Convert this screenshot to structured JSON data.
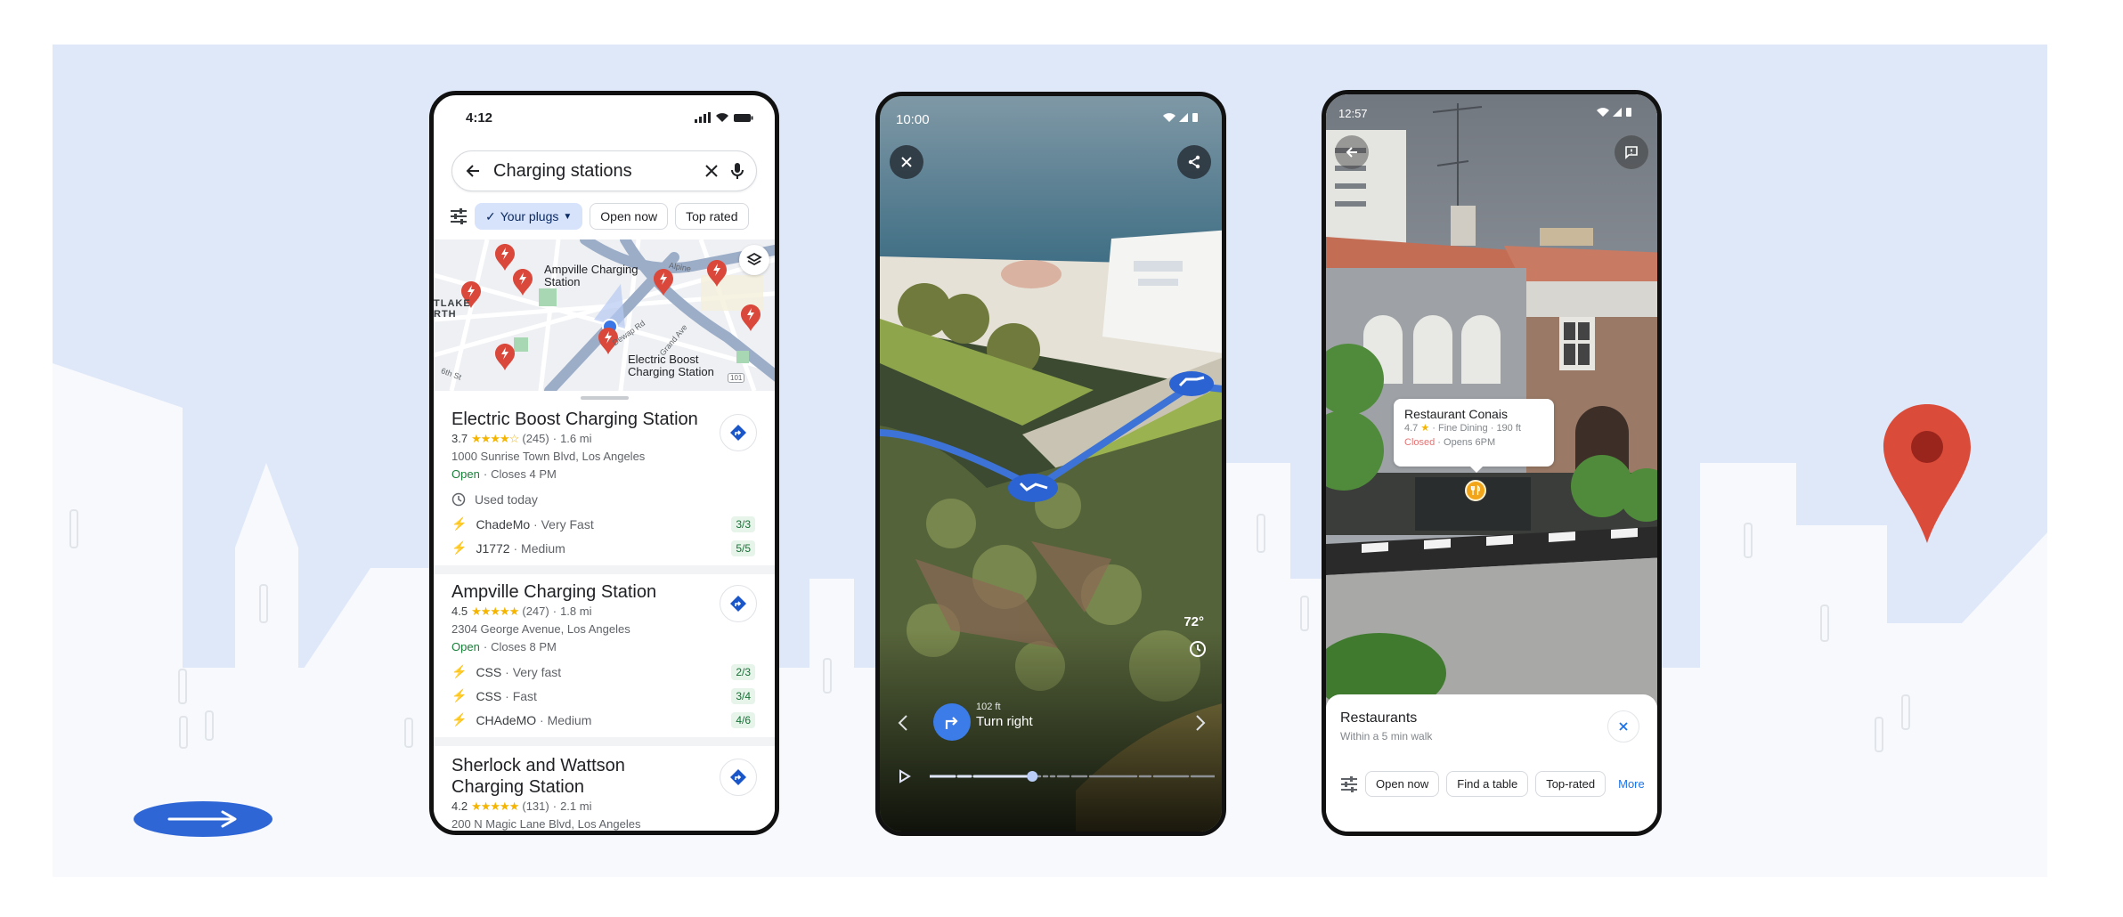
{
  "phone_search": {
    "status_time": "4:12",
    "search": {
      "query": "Charging stations"
    },
    "filter_chips": [
      {
        "label": "Your plugs",
        "active": true
      },
      {
        "label": "Open now",
        "active": false
      },
      {
        "label": "Top rated",
        "active": false
      }
    ],
    "map_labels": {
      "ampville": [
        "Ampville Charging",
        "Station"
      ],
      "electric_boost": [
        "Electric Boost",
        "Charging Station"
      ],
      "street_dewap": "Dewap Rd",
      "street_grand": "Grand Ave",
      "street_alpine": "Alpine",
      "street_6th": "6th St",
      "area_westlake": [
        "TLAKE",
        "RTH"
      ],
      "highway": "101"
    },
    "results": [
      {
        "name": "Electric Boost Charging Station",
        "rating": "3.7",
        "stars": "★★★★☆",
        "reviews": "(245)",
        "distance": "1.6 mi",
        "address": "1000 Sunrise Town Blvd, Los Angeles",
        "status": "Open",
        "hours": "Closes 4 PM",
        "used": "Used today",
        "plugs": [
          {
            "type": "ChadeMo",
            "speed": "Very Fast",
            "avail": "3/3"
          },
          {
            "type": "J1772",
            "speed": "Medium",
            "avail": "5/5"
          }
        ]
      },
      {
        "name": "Ampville Charging Station",
        "rating": "4.5",
        "stars": "★★★★★",
        "reviews": "(247)",
        "distance": "1.8 mi",
        "address": "2304 George Avenue, Los Angeles",
        "status": "Open",
        "hours": "Closes 8 PM",
        "plugs": [
          {
            "type": "CSS",
            "speed": "Very fast",
            "avail": "2/3"
          },
          {
            "type": "CSS",
            "speed": "Fast",
            "avail": "3/4"
          },
          {
            "type": "CHAdeMO",
            "speed": "Medium",
            "avail": "4/6"
          }
        ]
      },
      {
        "name": "Sherlock and Wattson Charging Station",
        "rating": "4.2",
        "stars": "★★★★★",
        "reviews": "(131)",
        "distance": "2.1 mi",
        "address": "200 N Magic Lane Blvd, Los Angeles"
      }
    ]
  },
  "phone_immersive": {
    "status_time": "10:00",
    "temperature": "72°",
    "step": {
      "distance": "102 ft",
      "instruction": "Turn right"
    },
    "route_progress": 0.36
  },
  "phone_lens": {
    "status_time": "12:57",
    "poi": {
      "name": "Restaurant Conais",
      "rating": "4.7",
      "category": "Fine Dining",
      "distance": "190 ft",
      "status": "Closed",
      "hours": "Opens 6PM"
    },
    "sheet": {
      "title": "Restaurants",
      "subtitle": "Within a 5 min walk",
      "chips": [
        "Open now",
        "Find a table",
        "Top-rated"
      ],
      "more": "More"
    }
  },
  "colors": {
    "panel_bg": "#dfe8f9",
    "google_blue": "#1a73e8",
    "pin_red": "#db4437",
    "open_green": "#188038",
    "closed_red": "#d93025"
  }
}
